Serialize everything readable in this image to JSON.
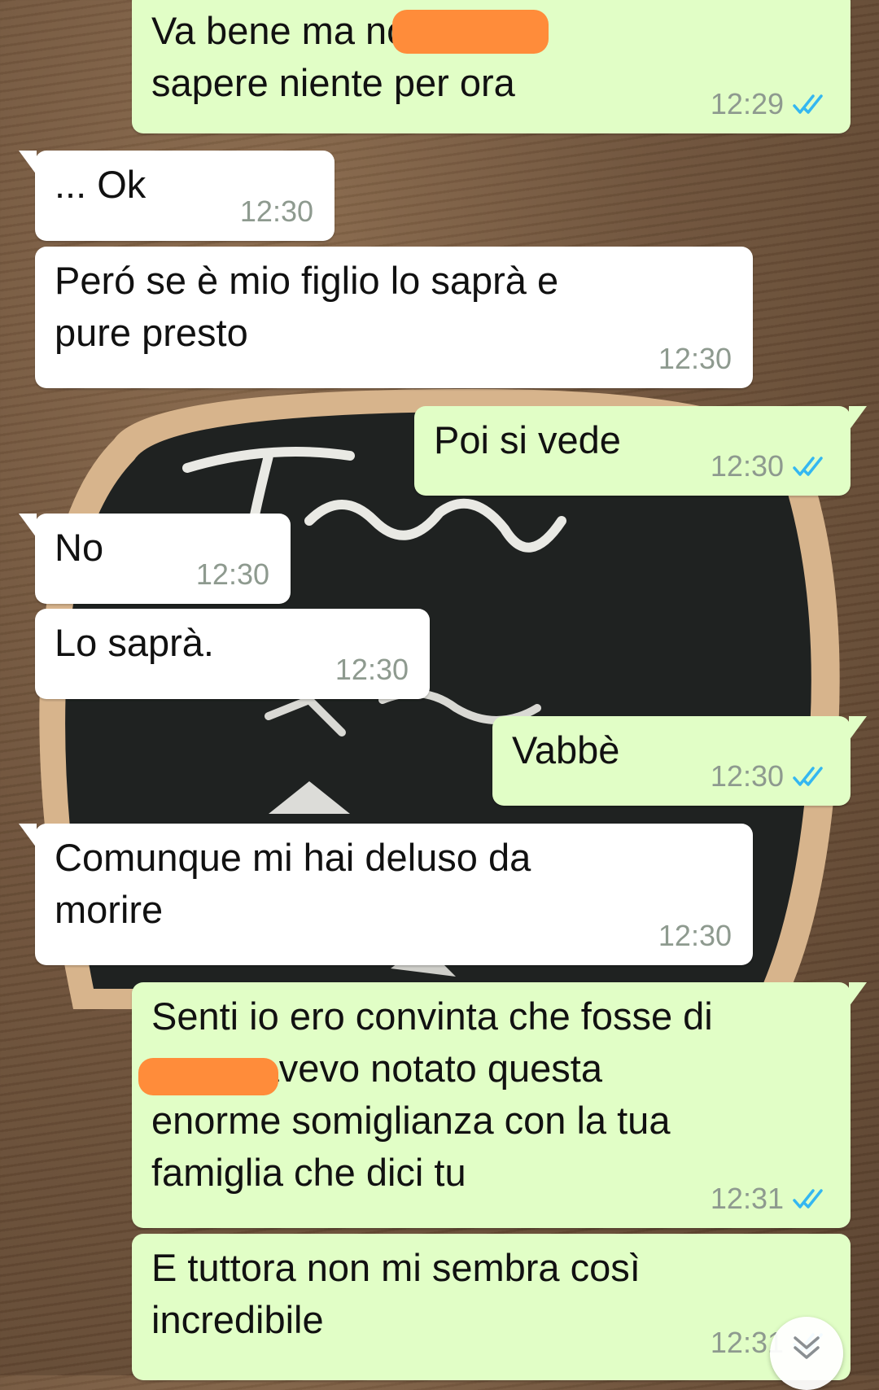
{
  "colors": {
    "outgoing_bubble": "#e1fec6",
    "incoming_bubble": "#ffffff",
    "read_ticks": "#34b7f1",
    "timestamp": "#8e9a8f",
    "redaction": "#ff8c3a"
  },
  "messages": [
    {
      "direction": "out",
      "text": "Va bene ma                non deve\nsapere niente per ora",
      "time": "12:29",
      "status_icon": "double-check-read-icon"
    },
    {
      "direction": "in",
      "text": "... Ok",
      "time": "12:30"
    },
    {
      "direction": "in",
      "text": "Peró se è mio figlio lo saprà e\npure presto",
      "time": "12:30"
    },
    {
      "direction": "out",
      "text": "Poi si vede",
      "time": "12:30",
      "status_icon": "double-check-read-icon"
    },
    {
      "direction": "in",
      "text": "No",
      "time": "12:30"
    },
    {
      "direction": "in",
      "text": "Lo saprà.",
      "time": "12:30"
    },
    {
      "direction": "out",
      "text": "Vabbè",
      "time": "12:30",
      "status_icon": "double-check-read-icon"
    },
    {
      "direction": "in",
      "text": "Comunque mi hai deluso da\nmorire",
      "time": "12:30"
    },
    {
      "direction": "out",
      "text": "Senti io ero convinta che fosse di\n               o non avevo notato questa\nenorme somiglianza con la tua\nfamiglia che dici tu",
      "time": "12:31",
      "status_icon": "double-check-read-icon"
    },
    {
      "direction": "out",
      "text": "E tuttora non mi sembra così\nincredibile",
      "time": "12:31",
      "status_icon": "double-check-read-icon"
    }
  ],
  "scroll_to_bottom_icon": "double-chevron-down-icon"
}
